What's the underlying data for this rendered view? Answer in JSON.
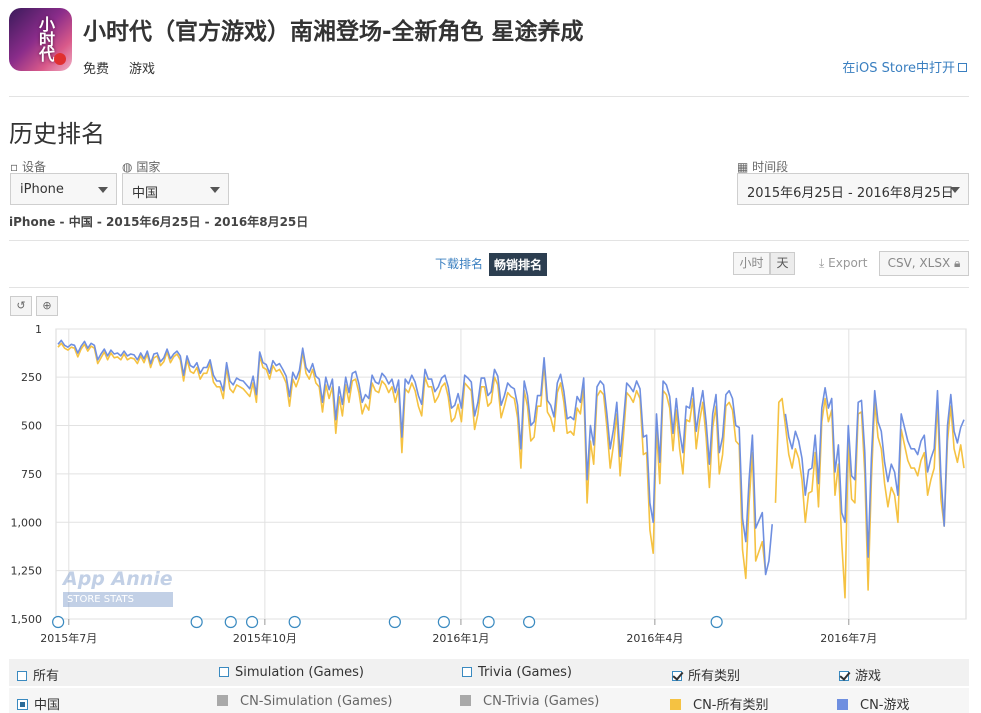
{
  "app": {
    "title": "小时代（官方游戏）南湘登场-全新角色 星途养成",
    "price": "免费",
    "category": "游戏",
    "icon_text": "小时代",
    "store_link": "在iOS Store中打开"
  },
  "section_title": "历史排名",
  "filters": {
    "device_label": "设备",
    "device_value": "iPhone",
    "country_label": "国家",
    "country_value": "中国",
    "period_label": "时间段",
    "period_value": "2015年6月25日 - 2016年8月25日",
    "summary": "iPhone - 中国 - 2015年6月25日 - 2016年8月25日"
  },
  "tabs": {
    "downloads": "下载排名",
    "grossing": "畅销排名"
  },
  "granularity": {
    "hour": "小时",
    "day": "天"
  },
  "export": {
    "label": "Export",
    "formats": "CSV, XLSX"
  },
  "watermark": {
    "brand": "App Annie",
    "sub": "STORE STATS"
  },
  "colors": {
    "all_categories": "#f5c242",
    "games": "#6f8fe0",
    "gray": "#a9a9a9",
    "accent": "#2c3e50"
  },
  "chart_data": {
    "type": "line",
    "y_reversed": true,
    "ylim": [
      1,
      1500
    ],
    "ytick_labels": [
      "1",
      "250",
      "500",
      "750",
      "1,000",
      "1,250",
      "1,500"
    ],
    "yticks": [
      1,
      250,
      500,
      750,
      1000,
      1250,
      1500
    ],
    "x_start": "2015-06-25",
    "x_end": "2016-08-25",
    "xtick_labels": [
      "2015年7月",
      "2015年10月",
      "2016年1月",
      "2016年4月",
      "2016年7月"
    ],
    "series": [
      {
        "name": "CN-所有类别",
        "color": "#f5c242",
        "values": [
          95,
          75,
          100,
          110,
          95,
          100,
          145,
          105,
          80,
          115,
          90,
          100,
          180,
          150,
          120,
          160,
          125,
          150,
          145,
          160,
          130,
          160,
          150,
          155,
          180,
          140,
          175,
          130,
          200,
          150,
          140,
          190,
          170,
          120,
          175,
          145,
          130,
          160,
          270,
          160,
          220,
          230,
          200,
          260,
          230,
          230,
          180,
          275,
          300,
          300,
          360,
          200,
          310,
          330,
          290,
          300,
          310,
          330,
          350,
          280,
          380,
          140,
          200,
          210,
          260,
          190,
          220,
          210,
          240,
          280,
          400,
          260,
          300,
          250,
          120,
          230,
          260,
          210,
          280,
          300,
          430,
          290,
          360,
          300,
          540,
          350,
          450,
          290,
          380,
          270,
          260,
          330,
          440,
          390,
          420,
          280,
          320,
          330,
          270,
          290,
          330,
          300,
          380,
          310,
          640,
          310,
          330,
          280,
          320,
          400,
          450,
          250,
          300,
          300,
          380,
          350,
          300,
          280,
          350,
          480,
          460,
          390,
          480,
          280,
          300,
          320,
          520,
          440,
          300,
          300,
          400,
          380,
          250,
          290,
          460,
          400,
          330,
          350,
          360,
          460,
          720,
          320,
          400,
          580,
          560,
          400,
          400,
          180,
          430,
          460,
          530,
          330,
          280,
          380,
          540,
          530,
          550,
          410,
          440,
          300,
          900,
          580,
          700,
          350,
          320,
          340,
          510,
          720,
          600,
          440,
          760,
          560,
          330,
          350,
          380,
          320,
          360,
          650,
          640,
          1040,
          1160,
          520,
          800,
          320,
          340,
          410,
          630,
          420,
          620,
          750,
          470,
          480,
          360,
          620,
          480,
          380,
          560,
          820,
          510,
          400,
          750,
          650,
          400,
          380,
          420,
          580,
          600,
          1140,
          1290,
          900,
          640,
          1200,
          1150,
          1100,
          1260,
          null,
          null,
          900,
          380,
          360,
          500,
          650,
          720,
          620,
          670,
          780,
          1000,
          850,
          840,
          640,
          920,
          480,
          360,
          480,
          420,
          860,
          700,
          1100,
          1390,
          580,
          880,
          900,
          440,
          430,
          750,
          1350,
          780,
          380,
          560,
          620,
          800,
          920,
          820,
          860,
          1000,
          520,
          600,
          680,
          720,
          720,
          760,
          680,
          640,
          860,
          780,
          720,
          380,
          880,
          1020,
          580,
          400,
          620,
          690,
          600,
          720
        ],
        "values_note": "daily rank; null = no rank"
      },
      {
        "name": "CN-游戏",
        "color": "#6f8fe0",
        "values": [
          80,
          60,
          85,
          95,
          80,
          85,
          125,
          90,
          65,
          100,
          75,
          85,
          160,
          130,
          105,
          140,
          110,
          130,
          125,
          140,
          115,
          140,
          130,
          135,
          160,
          125,
          155,
          115,
          180,
          130,
          125,
          170,
          150,
          105,
          155,
          130,
          115,
          140,
          240,
          140,
          190,
          200,
          175,
          230,
          200,
          200,
          160,
          240,
          270,
          270,
          320,
          175,
          270,
          290,
          255,
          265,
          270,
          290,
          310,
          245,
          340,
          120,
          175,
          185,
          230,
          165,
          190,
          180,
          210,
          245,
          350,
          225,
          260,
          215,
          100,
          200,
          225,
          180,
          245,
          260,
          380,
          250,
          315,
          260,
          470,
          300,
          390,
          250,
          330,
          230,
          220,
          285,
          380,
          340,
          360,
          240,
          275,
          285,
          230,
          250,
          285,
          260,
          330,
          265,
          560,
          260,
          285,
          240,
          275,
          345,
          390,
          210,
          260,
          260,
          325,
          300,
          255,
          240,
          300,
          410,
          395,
          335,
          410,
          240,
          255,
          275,
          450,
          380,
          255,
          255,
          345,
          325,
          210,
          245,
          395,
          345,
          280,
          300,
          310,
          395,
          620,
          270,
          345,
          500,
          480,
          345,
          345,
          150,
          370,
          395,
          455,
          280,
          235,
          325,
          465,
          455,
          470,
          350,
          380,
          255,
          780,
          500,
          600,
          300,
          270,
          290,
          440,
          620,
          520,
          380,
          660,
          480,
          280,
          300,
          325,
          270,
          310,
          560,
          550,
          900,
          1000,
          440,
          690,
          270,
          290,
          350,
          540,
          360,
          530,
          640,
          400,
          410,
          305,
          530,
          410,
          320,
          480,
          700,
          440,
          340,
          640,
          560,
          340,
          320,
          360,
          500,
          510,
          980,
          1100,
          780,
          550,
          1030,
          990,
          950,
          1270,
          1200,
          1010,
          null,
          null,
          null,
          440,
          560,
          620,
          530,
          580,
          670,
          860,
          730,
          720,
          550,
          800,
          410,
          305,
          410,
          360,
          740,
          600,
          950,
          1000,
          500,
          760,
          780,
          380,
          370,
          640,
          1180,
          670,
          320,
          480,
          530,
          690,
          790,
          700,
          740,
          860,
          440,
          510,
          580,
          620,
          620,
          650,
          580,
          550,
          740,
          670,
          620,
          320,
          760,
          1020,
          500,
          340,
          530,
          590,
          510,
          470
        ]
      }
    ],
    "markers": [
      "2015-06-26",
      "2015-08-30",
      "2015-09-15",
      "2015-09-25",
      "2015-10-15",
      "2015-12-01",
      "2015-12-24",
      "2016-01-14",
      "2016-02-02",
      "2016-04-30"
    ]
  },
  "legend": {
    "row1": [
      {
        "label": "所有",
        "checked": false
      },
      {
        "label": "Simulation (Games)",
        "checked": false
      },
      {
        "label": "Trivia (Games)",
        "checked": false
      },
      {
        "label": "所有类别",
        "checked": true
      },
      {
        "label": "游戏",
        "checked": true
      }
    ],
    "row2": [
      {
        "label": "中国",
        "selected": true
      },
      {
        "label": "CN-Simulation (Games)",
        "color": "#a9a9a9"
      },
      {
        "label": "CN-Trivia (Games)",
        "color": "#a9a9a9"
      },
      {
        "label": "CN-所有类别",
        "color": "#f5c242"
      },
      {
        "label": "CN-游戏",
        "color": "#6f8fe0"
      }
    ]
  }
}
